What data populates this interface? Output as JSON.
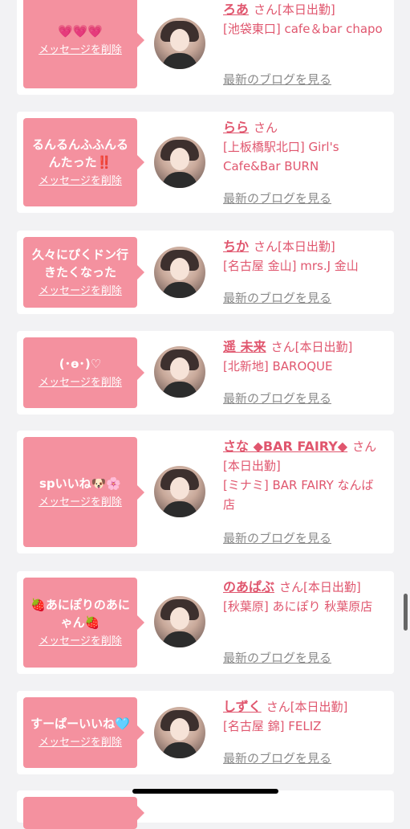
{
  "common": {
    "delete_label": "メッセージを削除",
    "blog_label": "最新のブログを見る",
    "san": "さん"
  },
  "items": [
    {
      "message": "💗💗💗",
      "name": "ろあ",
      "status": "[本日出勤]",
      "shop": "[池袋東口] cafe＆bar chapo"
    },
    {
      "message": "るんるんふふんるんたった‼️",
      "name": "らら",
      "status": "",
      "shop": "[上板橋駅北口] Girl's Cafe&Bar BURN"
    },
    {
      "message": "久々にぴくドン行きたくなった",
      "name": "ちか",
      "status": "[本日出勤]",
      "shop": "[名古屋 金山] mrs.J 金山"
    },
    {
      "message": "(･ө･)♡",
      "name": "遥 未来",
      "status": "[本日出勤]",
      "shop": "[北新地] BAROQUE"
    },
    {
      "message": "spいいね🐶🌸",
      "name": "さな ◆BAR FAIRY◆",
      "status": "[本日出勤]",
      "shop": "[ミナミ] BAR FAIRY なんば店"
    },
    {
      "message": "🍓あにぽりのあにゃん🍓",
      "name": "のあぱぶ",
      "status": "[本日出勤]",
      "shop": "[秋葉原] あにぽり 秋葉原店"
    },
    {
      "message": "すーぱーいいね🩵",
      "name": "しずく",
      "status": "[本日出勤]",
      "shop": "[名古屋 錦] FELIZ"
    }
  ]
}
